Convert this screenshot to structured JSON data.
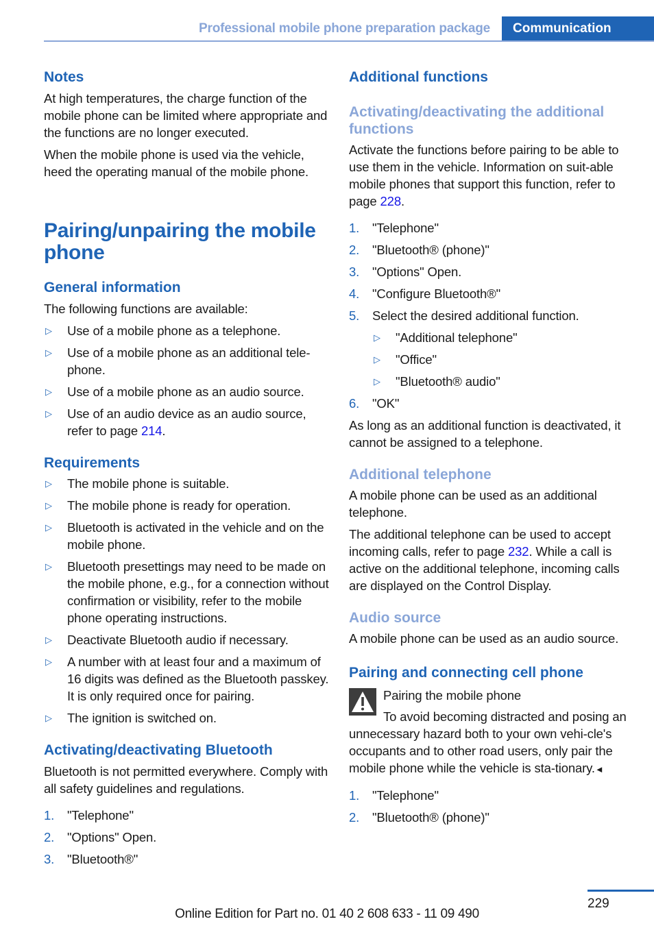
{
  "header": {
    "section": "Professional mobile phone preparation package",
    "chapter": "Communication"
  },
  "left": {
    "notes": {
      "heading": "Notes",
      "p1": "At high temperatures, the charge function of the mobile phone can be limited where appropriate and the functions are no longer executed.",
      "p2": "When the mobile phone is used via the vehicle, heed the operating manual of the mobile phone."
    },
    "main_title": "Pairing/unpairing the mobile phone",
    "general": {
      "heading": "General information",
      "intro": "The following functions are available:",
      "items": [
        "Use of a mobile phone as a telephone.",
        "Use of a mobile phone as an additional tele-phone.",
        "Use of a mobile phone as an audio source."
      ],
      "item4_text": "Use of an audio device as an audio source, refer to page ",
      "item4_link": "214",
      "item4_end": "."
    },
    "requirements": {
      "heading": "Requirements",
      "items": [
        "The mobile phone is suitable.",
        "The mobile phone is ready for operation.",
        "Bluetooth is activated in the vehicle and on the mobile phone.",
        "Bluetooth presettings may need to be made on the mobile phone, e.g., for a connection without confirmation or visibility, refer to the mobile phone operating instructions.",
        "Deactivate Bluetooth audio if necessary.",
        "A number with at least four and a maximum of 16 digits was defined as the Bluetooth passkey. It is only required once for pairing.",
        "The ignition is switched on."
      ]
    },
    "bluetooth": {
      "heading": "Activating/deactivating Bluetooth",
      "intro": "Bluetooth is not permitted everywhere. Comply with all safety guidelines and regulations.",
      "steps": [
        {
          "n": "1.",
          "text": "\"Telephone\""
        },
        {
          "n": "2.",
          "text": "\"Options\" Open."
        },
        {
          "n": "3.",
          "text": "\"Bluetooth®\""
        }
      ]
    }
  },
  "right": {
    "additional": {
      "heading": "Additional functions",
      "subheading": "Activating/deactivating the additional functions",
      "intro_text": "Activate the functions before pairing to be able to use them in the vehicle. Information on suit-able mobile phones that support this function, refer to page ",
      "intro_link": "228",
      "intro_end": ".",
      "steps": [
        {
          "n": "1.",
          "text": "\"Telephone\""
        },
        {
          "n": "2.",
          "text": "\"Bluetooth® (phone)\""
        },
        {
          "n": "3.",
          "text": "\"Options\" Open."
        },
        {
          "n": "4.",
          "text": "\"Configure Bluetooth®\""
        },
        {
          "n": "5.",
          "text": "Select the desired additional function."
        }
      ],
      "sub_options": [
        "\"Additional telephone\"",
        "\"Office\"",
        "\"Bluetooth® audio\""
      ],
      "step6": {
        "n": "6.",
        "text": "\"OK\""
      },
      "note": "As long as an additional function is deactivated, it cannot be assigned to a telephone."
    },
    "additional_telephone": {
      "heading": "Additional telephone",
      "p1": "A mobile phone can be used as an additional telephone.",
      "p2_text": "The additional telephone can be used to accept incoming calls, refer to page ",
      "p2_link": "232",
      "p2_end": ". While a call is active on the additional telephone, incoming calls are displayed on the Control Display."
    },
    "audio_source": {
      "heading": "Audio source",
      "p1": "A mobile phone can be used as an audio source."
    },
    "pairing": {
      "heading": "Pairing and connecting cell phone",
      "warning_icon": "warning-triangle-icon",
      "warning_title": "Pairing the mobile phone",
      "warning_text": "To avoid becoming distracted and posing an unnecessary hazard both to your own vehi-cle's occupants and to other road users, only pair the mobile phone while the vehicle is sta-tionary.",
      "warning_end": "◄",
      "steps": [
        {
          "n": "1.",
          "text": "\"Telephone\""
        },
        {
          "n": "2.",
          "text": "\"Bluetooth® (phone)\""
        }
      ]
    }
  },
  "footer": {
    "page_number": "229",
    "edition": "Online Edition for Part no. 01 40 2 608 633 - 11 09 490"
  },
  "colors": {
    "primary_blue": "#1f64b5",
    "light_blue": "#8aa6d8",
    "link_blue": "#1414e6"
  }
}
